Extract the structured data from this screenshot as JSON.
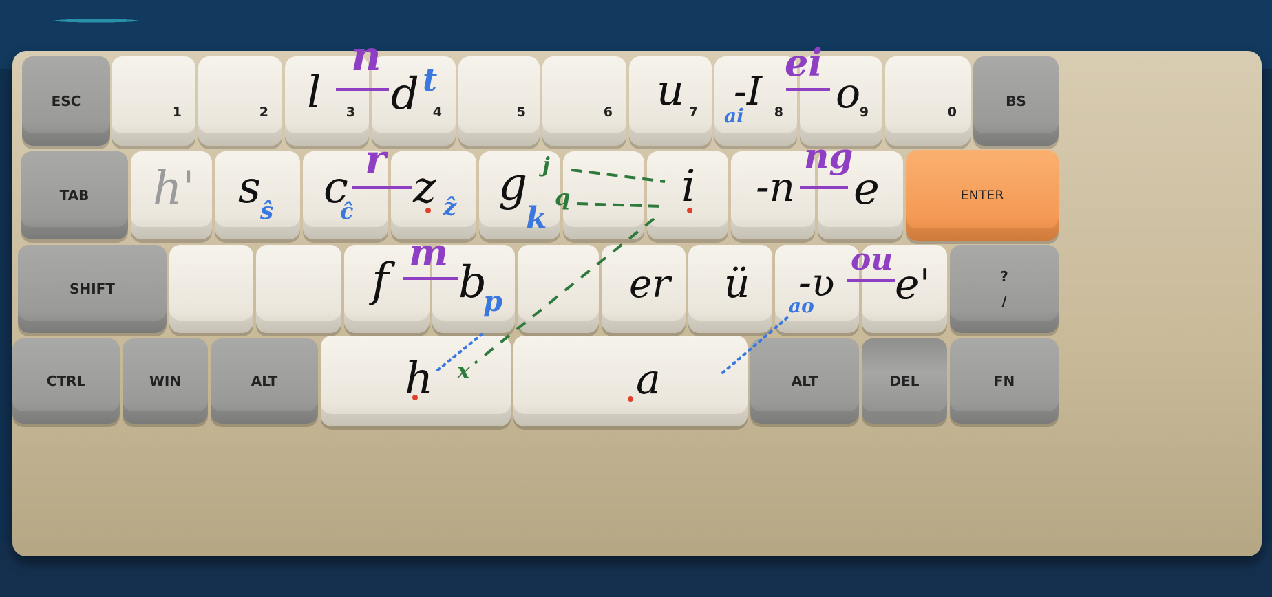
{
  "keys": {
    "esc": "ESC",
    "k1": "1",
    "k2": "2",
    "k3": "3",
    "k4": "4",
    "k5": "5",
    "k6": "6",
    "k7": "7",
    "k8": "8",
    "k9": "9",
    "k0": "0",
    "bs": "BS",
    "tab": "TAB",
    "enter": "ENTER",
    "shift": "SHIFT",
    "question": "?",
    "slash": "/",
    "ctrl": "CTRL",
    "win": "WIN",
    "alt_left": "ALT",
    "alt_right": "ALT",
    "del": "DEL",
    "fn": "FN"
  },
  "annotations": {
    "black": {
      "l": "l",
      "d": "d",
      "u": "u",
      "I": "-I",
      "o": "o",
      "h_apos": "h'",
      "s": "s",
      "c": "c",
      "z": "z",
      "g": "g",
      "i": "i",
      "n": "-n",
      "e": "e",
      "f": "f",
      "b": "b",
      "er": "er",
      "u_umlaut": "ü",
      "v": "-ʋ",
      "e_apos": "e'",
      "h": "h",
      "a": "a"
    },
    "purple": {
      "n": "n",
      "ei": "ei",
      "r": "r",
      "ng": "ng",
      "m": "m",
      "ou": "ou"
    },
    "blue": {
      "t": "t",
      "ai": "ai",
      "s_hat": "ŝ",
      "c_hat": "ĉ",
      "z_hat": "ẑ",
      "k": "k",
      "p": "p",
      "ao": "ao"
    },
    "green": {
      "j": "j",
      "q": "q",
      "x": "x"
    }
  },
  "colors": {
    "purple": "#8e3fc4",
    "blue": "#3a78e0",
    "green": "#2e7a3c",
    "red_dot": "#e0402a",
    "ink": "#111111",
    "gray_ink": "#9b9b9b"
  }
}
